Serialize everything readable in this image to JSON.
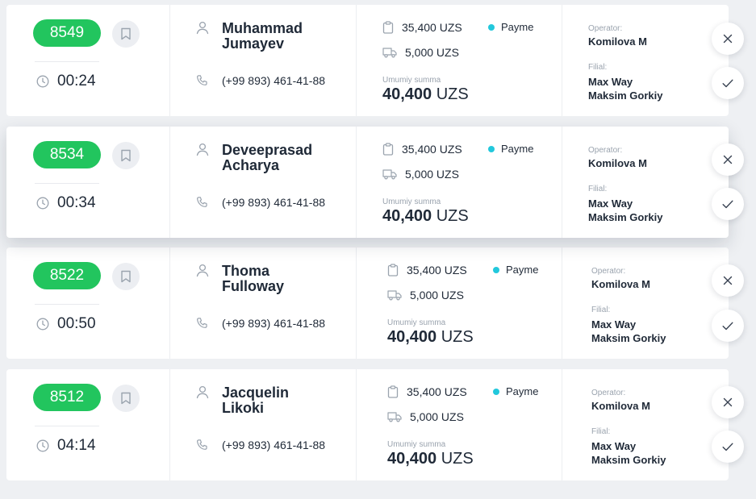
{
  "labels": {
    "total_label": "Umumiy summa",
    "currency": "UZS",
    "operator_label": "Operator:",
    "filial_label": "Filial:"
  },
  "orders": [
    {
      "id": "8549",
      "timer": "00:24",
      "name_line1": "Muhammad",
      "name_line2": "Jumayev",
      "phone": "(+99 893) 461-41-88",
      "order_amount": "35,400 UZS",
      "payment": "Payme",
      "delivery_amount": "5,000 UZS",
      "total": "40,400",
      "operator": "Komilova M",
      "filial_line1": "Max Way",
      "filial_line2": "Maksim Gorkiy"
    },
    {
      "id": "8534",
      "timer": "00:34",
      "name_line1": "Deveeprasad",
      "name_line2": "Acharya",
      "phone": "(+99 893) 461-41-88",
      "order_amount": "35,400 UZS",
      "payment": "Payme",
      "delivery_amount": "5,000 UZS",
      "total": "40,400",
      "operator": "Komilova M",
      "filial_line1": "Max Way",
      "filial_line2": "Maksim Gorkiy"
    },
    {
      "id": "8522",
      "timer": "00:50",
      "name_line1": "Thoma",
      "name_line2": "Fulloway",
      "phone": "(+99 893) 461-41-88",
      "order_amount": "35,400 UZS",
      "payment": "Payme",
      "delivery_amount": "5,000 UZS",
      "total": "40,400",
      "operator": "Komilova M",
      "filial_line1": "Max Way",
      "filial_line2": "Maksim Gorkiy"
    },
    {
      "id": "8512",
      "timer": "04:14",
      "name_line1": "Jacquelin",
      "name_line2": "Likoki",
      "phone": "(+99 893) 461-41-88",
      "order_amount": "35,400 UZS",
      "payment": "Payme",
      "delivery_amount": "5,000 UZS",
      "total": "40,400",
      "operator": "Komilova M",
      "filial_line1": "Max Way",
      "filial_line2": "Maksim Gorkiy"
    }
  ],
  "icons": {
    "bookmark": "bookmark-icon",
    "clock": "clock-icon",
    "user": "user-icon",
    "phone": "phone-icon",
    "clipboard": "clipboard-icon",
    "truck": "truck-icon",
    "close": "close-icon",
    "check": "check-icon"
  },
  "colors": {
    "badge_green": "#22c55e",
    "payme_dot": "#22c8dc",
    "background": "#eef0f3"
  }
}
